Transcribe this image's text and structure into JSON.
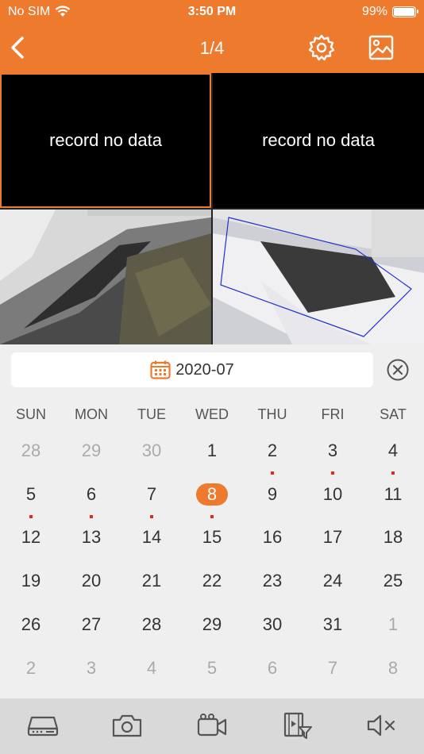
{
  "status_bar": {
    "carrier": "No SIM",
    "time": "3:50 PM",
    "battery": "99%",
    "battery_level": 0.99
  },
  "nav": {
    "title": "1/4",
    "icons": [
      "back-chevron-icon",
      "gear-icon",
      "image-gallery-icon"
    ]
  },
  "video_grid": {
    "cells": [
      {
        "text": "record no data"
      },
      {
        "text": "record no data"
      },
      {
        "text": ""
      },
      {
        "text": ""
      }
    ]
  },
  "calendar": {
    "month_label": "2020-07",
    "weekdays": [
      "SUN",
      "MON",
      "TUE",
      "WED",
      "THU",
      "FRI",
      "SAT"
    ],
    "days": [
      {
        "d": "28",
        "m": true
      },
      {
        "d": "29",
        "m": true
      },
      {
        "d": "30",
        "m": true
      },
      {
        "d": "1"
      },
      {
        "d": "2",
        "r": true
      },
      {
        "d": "3",
        "r": true
      },
      {
        "d": "4",
        "r": true
      },
      {
        "d": "5",
        "r": true
      },
      {
        "d": "6",
        "r": true
      },
      {
        "d": "7",
        "r": true
      },
      {
        "d": "8",
        "r": true,
        "s": true
      },
      {
        "d": "9"
      },
      {
        "d": "10"
      },
      {
        "d": "11"
      },
      {
        "d": "12"
      },
      {
        "d": "13"
      },
      {
        "d": "14"
      },
      {
        "d": "15"
      },
      {
        "d": "16"
      },
      {
        "d": "17"
      },
      {
        "d": "18"
      },
      {
        "d": "19"
      },
      {
        "d": "20"
      },
      {
        "d": "21"
      },
      {
        "d": "22"
      },
      {
        "d": "23"
      },
      {
        "d": "24"
      },
      {
        "d": "25"
      },
      {
        "d": "26"
      },
      {
        "d": "27"
      },
      {
        "d": "28"
      },
      {
        "d": "29"
      },
      {
        "d": "30"
      },
      {
        "d": "31"
      },
      {
        "d": "1",
        "m": true
      },
      {
        "d": "2",
        "m": true
      },
      {
        "d": "3",
        "m": true
      },
      {
        "d": "4",
        "m": true
      },
      {
        "d": "5",
        "m": true
      },
      {
        "d": "6",
        "m": true
      },
      {
        "d": "7",
        "m": true
      },
      {
        "d": "8",
        "m": true
      }
    ]
  },
  "toolbar": {
    "icons": [
      "nvr-device-icon",
      "camera-snapshot-icon",
      "video-record-icon",
      "video-filter-icon",
      "mute-icon"
    ]
  },
  "colors": {
    "accent": "#ee7a2e",
    "record_dot": "#e02b20"
  }
}
